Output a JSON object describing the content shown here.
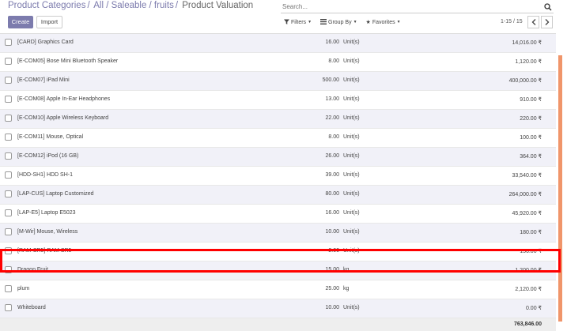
{
  "breadcrumb": {
    "items": [
      "Product Categories",
      "All / Saleable / fruits"
    ],
    "current": "Product Valuation"
  },
  "search": {
    "placeholder": "Search..."
  },
  "buttons": {
    "create": "Create",
    "import": "Import"
  },
  "filters": {
    "filters": "Filters",
    "group_by": "Group By",
    "favorites": "Favorites"
  },
  "pager": {
    "range": "1-15 / 15"
  },
  "rows": [
    {
      "name": "[CARD] Graphics Card",
      "qty": "16.00",
      "uom": "Unit(s)",
      "value": "14,016.00 ₹"
    },
    {
      "name": "[E-COM05] Bose Mini Bluetooth Speaker",
      "qty": "8.00",
      "uom": "Unit(s)",
      "value": "1,120.00 ₹"
    },
    {
      "name": "[E-COM07] iPad Mini",
      "qty": "500.00",
      "uom": "Unit(s)",
      "value": "400,000.00 ₹"
    },
    {
      "name": "[E-COM08] Apple In-Ear Headphones",
      "qty": "13.00",
      "uom": "Unit(s)",
      "value": "910.00 ₹"
    },
    {
      "name": "[E-COM10] Apple Wireless Keyboard",
      "qty": "22.00",
      "uom": "Unit(s)",
      "value": "220.00 ₹"
    },
    {
      "name": "[E-COM11] Mouse, Optical",
      "qty": "8.00",
      "uom": "Unit(s)",
      "value": "100.00 ₹"
    },
    {
      "name": "[E-COM12] iPod (16 GB)",
      "qty": "26.00",
      "uom": "Unit(s)",
      "value": "364.00 ₹"
    },
    {
      "name": "[HDD-SH1] HDD SH-1",
      "qty": "39.00",
      "uom": "Unit(s)",
      "value": "33,540.00 ₹"
    },
    {
      "name": "[LAP-CUS] Laptop Customized",
      "qty": "80.00",
      "uom": "Unit(s)",
      "value": "264,000.00 ₹"
    },
    {
      "name": "[LAP-E5] Laptop E5023",
      "qty": "16.00",
      "uom": "Unit(s)",
      "value": "45,920.00 ₹"
    },
    {
      "name": "[M-Wir] Mouse, Wireless",
      "qty": "10.00",
      "uom": "Unit(s)",
      "value": "180.00 ₹"
    },
    {
      "name": "[RAM-SR5] RAM SR5",
      "qty": "2.00",
      "uom": "Unit(s)",
      "value": "156.00 ₹"
    },
    {
      "name": "Dragon Fruit",
      "qty": "15.00",
      "uom": "kg",
      "value": "1,200.00 ₹"
    },
    {
      "name": "plum",
      "qty": "25.00",
      "uom": "kg",
      "value": "2,120.00 ₹"
    },
    {
      "name": "Whiteboard",
      "qty": "10.00",
      "uom": "Unit(s)",
      "value": "0.00 ₹"
    }
  ],
  "total": "763,846.00",
  "colors": {
    "accent": "#7c7bad",
    "highlight": "#ff0000",
    "scroll": "#f0956a"
  }
}
